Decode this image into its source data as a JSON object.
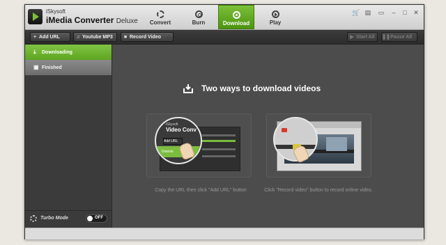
{
  "app": {
    "brand_small": "iSkysoft",
    "brand_name": "iMedia Converter",
    "brand_edition": "Deluxe"
  },
  "tabs": [
    {
      "label": "Convert",
      "icon": "convert-icon",
      "active": false
    },
    {
      "label": "Burn",
      "icon": "burn-icon",
      "active": false
    },
    {
      "label": "Download",
      "icon": "download-icon",
      "active": true
    },
    {
      "label": "Play",
      "icon": "play-icon",
      "active": false
    }
  ],
  "window_controls": [
    "cart-icon",
    "settings-icon",
    "chat-icon",
    "minimize-icon",
    "maximize-icon",
    "close-icon"
  ],
  "toolbar": {
    "add_url": "Add URL",
    "youtube_mp3": "Youtube MP3",
    "record_video": "Record Video",
    "start_all": "Start All",
    "pause_all": "Pause All"
  },
  "sidebar": {
    "items": [
      {
        "label": "Downloading",
        "icon": "download-icon",
        "active": true
      },
      {
        "label": "Finished",
        "icon": "finished-icon",
        "active": false
      }
    ],
    "turbo_label": "Turbo Mode",
    "turbo_state": "OFF"
  },
  "main": {
    "heading": "Two ways to download videos",
    "card1": {
      "caption": "Copy the URL then click \"Add URL\" button",
      "mini_brand": "iSkysoft",
      "mini_title": "Video Conv",
      "mini_addurl": "Add URL",
      "mini_download": "Downlo"
    },
    "card2": {
      "caption": "Click \"Record video\" button to record online video."
    }
  },
  "colors": {
    "accent_green": "#6cb22c",
    "window_bg": "#4a4a4a",
    "sidebar_bg": "#3b3b3b"
  }
}
